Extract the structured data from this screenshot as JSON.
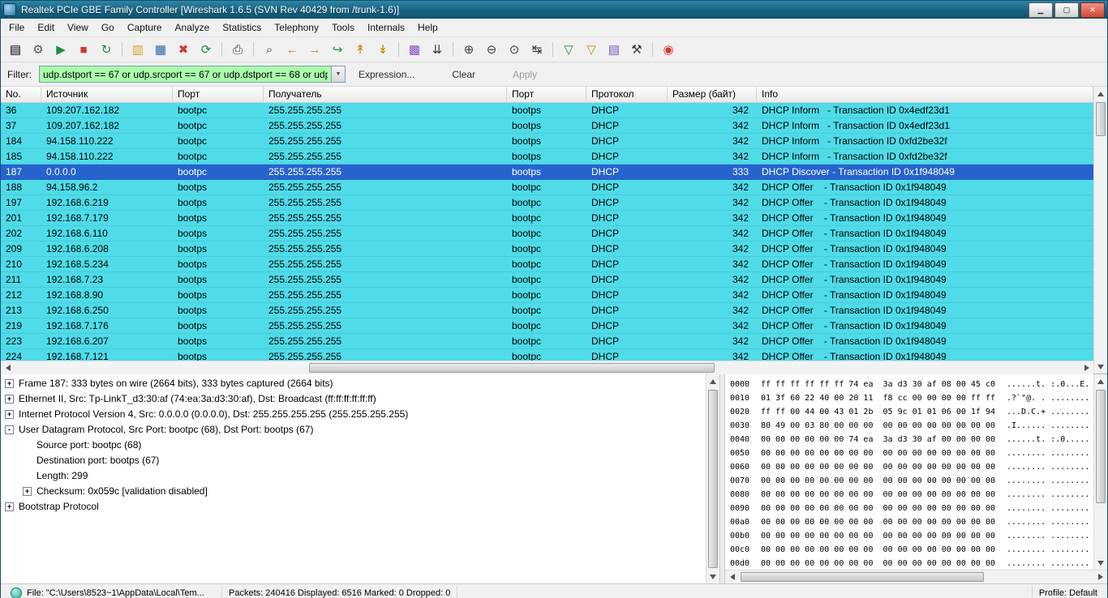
{
  "window": {
    "title": "Realtek PCIe GBE Family Controller   [Wireshark 1.6.5  (SVN Rev 40429 from /trunk-1.6)]",
    "controls": [
      {
        "name": "minimize-button",
        "glyph": "▁"
      },
      {
        "name": "maximize-button",
        "glyph": "▢"
      },
      {
        "name": "close-button",
        "glyph": "✕",
        "cls": "close"
      }
    ]
  },
  "menu": [
    {
      "name": "menu-file",
      "label": "File"
    },
    {
      "name": "menu-edit",
      "label": "Edit"
    },
    {
      "name": "menu-view",
      "label": "View"
    },
    {
      "name": "menu-go",
      "label": "Go"
    },
    {
      "name": "menu-capture",
      "label": "Capture"
    },
    {
      "name": "menu-analyze",
      "label": "Analyze"
    },
    {
      "name": "menu-statistics",
      "label": "Statistics"
    },
    {
      "name": "menu-telephony",
      "label": "Telephony"
    },
    {
      "name": "menu-tools",
      "label": "Tools"
    },
    {
      "name": "menu-internals",
      "label": "Internals"
    },
    {
      "name": "menu-help",
      "label": "Help"
    }
  ],
  "toolbar": [
    {
      "name": "list-interfaces-icon",
      "glyph": "▤",
      "cls": "c-dev"
    },
    {
      "name": "capture-options-icon",
      "glyph": "⚙",
      "cls": "c-gear"
    },
    {
      "name": "start-capture-icon",
      "glyph": "▶",
      "cls": "c-green"
    },
    {
      "name": "stop-capture-icon",
      "glyph": "■",
      "cls": "c-red"
    },
    {
      "name": "restart-capture-icon",
      "glyph": "↻",
      "cls": "c-green"
    },
    {
      "sep": true,
      "name": "toolbar-separator"
    },
    {
      "name": "open-file-icon",
      "glyph": "▥",
      "cls": "c-folder"
    },
    {
      "name": "save-file-icon",
      "glyph": "▦",
      "cls": "c-blue"
    },
    {
      "name": "close-file-icon",
      "glyph": "✖",
      "cls": "c-red"
    },
    {
      "name": "reload-icon",
      "glyph": "⟳",
      "cls": "c-green"
    },
    {
      "sep": true,
      "name": "toolbar-separator"
    },
    {
      "name": "print-icon",
      "glyph": "⎙",
      "cls": "c-dark"
    },
    {
      "sep": true,
      "name": "toolbar-separator"
    },
    {
      "name": "find-packet-icon",
      "glyph": "⌕",
      "cls": "c-dark"
    },
    {
      "name": "go-back-icon",
      "glyph": "←",
      "cls": "c-gold"
    },
    {
      "name": "go-forward-icon",
      "glyph": "→",
      "cls": "c-gold"
    },
    {
      "name": "goto-packet-icon",
      "glyph": "↪",
      "cls": "c-green"
    },
    {
      "name": "go-top-icon",
      "glyph": "↟",
      "cls": "c-gold"
    },
    {
      "name": "go-bottom-icon",
      "glyph": "↡",
      "cls": "c-gold"
    },
    {
      "sep": true,
      "name": "toolbar-separator"
    },
    {
      "name": "colorize-icon",
      "glyph": "▩",
      "cls": "c-multi"
    },
    {
      "name": "autoscroll-icon",
      "glyph": "⇊",
      "cls": "c-dark"
    },
    {
      "sep": true,
      "name": "toolbar-separator"
    },
    {
      "name": "zoom-in-icon",
      "glyph": "⊕",
      "cls": "c-dark"
    },
    {
      "name": "zoom-out-icon",
      "glyph": "⊖",
      "cls": "c-dark"
    },
    {
      "name": "zoom-100-icon",
      "glyph": "⊙",
      "cls": "c-dark"
    },
    {
      "name": "resize-columns-icon",
      "glyph": "↹",
      "cls": "c-dark"
    },
    {
      "sep": true,
      "name": "toolbar-separator"
    },
    {
      "name": "capture-filters-icon",
      "glyph": "▽",
      "cls": "c-green"
    },
    {
      "name": "display-filters-icon",
      "glyph": "▽",
      "cls": "c-gold"
    },
    {
      "name": "coloring-rules-icon",
      "glyph": "▤",
      "cls": "c-multi"
    },
    {
      "name": "preferences-icon",
      "glyph": "⚒",
      "cls": "c-dark"
    },
    {
      "sep": true,
      "name": "toolbar-separator"
    },
    {
      "name": "help-icon",
      "glyph": "◉",
      "cls": "c-red"
    }
  ],
  "filter": {
    "label": "Filter:",
    "value": "udp.dstport == 67 or udp.srcport == 67 or udp.dstport == 68 or udp.sr",
    "drop_glyph": "▼",
    "expression": "Expression...",
    "clear": "Clear",
    "apply": "Apply"
  },
  "packet_list": {
    "columns": [
      {
        "name": "col-no",
        "label": "No."
      },
      {
        "name": "col-source",
        "label": "Источник"
      },
      {
        "name": "col-src-port",
        "label": "Порт"
      },
      {
        "name": "col-destination",
        "label": "Получатель"
      },
      {
        "name": "col-dst-port",
        "label": "Порт"
      },
      {
        "name": "col-protocol",
        "label": "Протокол"
      },
      {
        "name": "col-length",
        "label": "Размер (байт)"
      },
      {
        "name": "col-info",
        "label": "Info"
      }
    ],
    "rows": [
      {
        "no": "36",
        "src": "109.207.162.182",
        "sport": "bootpc",
        "dst": "255.255.255.255",
        "dport": "bootps",
        "proto": "DHCP",
        "len": "342",
        "info": "DHCP Inform   - Transaction ID 0x4edf23d1"
      },
      {
        "no": "37",
        "src": "109.207.162.182",
        "sport": "bootpc",
        "dst": "255.255.255.255",
        "dport": "bootps",
        "proto": "DHCP",
        "len": "342",
        "info": "DHCP Inform   - Transaction ID 0x4edf23d1"
      },
      {
        "no": "184",
        "src": "94.158.110.222",
        "sport": "bootpc",
        "dst": "255.255.255.255",
        "dport": "bootps",
        "proto": "DHCP",
        "len": "342",
        "info": "DHCP Inform   - Transaction ID 0xfd2be32f"
      },
      {
        "no": "185",
        "src": "94.158.110.222",
        "sport": "bootpc",
        "dst": "255.255.255.255",
        "dport": "bootps",
        "proto": "DHCP",
        "len": "342",
        "info": "DHCP Inform   - Transaction ID 0xfd2be32f"
      },
      {
        "no": "187",
        "src": "0.0.0.0",
        "sport": "bootpc",
        "dst": "255.255.255.255",
        "dport": "bootps",
        "proto": "DHCP",
        "len": "333",
        "info": "DHCP Discover - Transaction ID 0x1f948049",
        "selected": true
      },
      {
        "no": "188",
        "src": "94.158.96.2",
        "sport": "bootps",
        "dst": "255.255.255.255",
        "dport": "bootpc",
        "proto": "DHCP",
        "len": "342",
        "info": "DHCP Offer    - Transaction ID 0x1f948049"
      },
      {
        "no": "197",
        "src": "192.168.6.219",
        "sport": "bootps",
        "dst": "255.255.255.255",
        "dport": "bootpc",
        "proto": "DHCP",
        "len": "342",
        "info": "DHCP Offer    - Transaction ID 0x1f948049"
      },
      {
        "no": "201",
        "src": "192.168.7.179",
        "sport": "bootps",
        "dst": "255.255.255.255",
        "dport": "bootpc",
        "proto": "DHCP",
        "len": "342",
        "info": "DHCP Offer    - Transaction ID 0x1f948049"
      },
      {
        "no": "202",
        "src": "192.168.6.110",
        "sport": "bootps",
        "dst": "255.255.255.255",
        "dport": "bootpc",
        "proto": "DHCP",
        "len": "342",
        "info": "DHCP Offer    - Transaction ID 0x1f948049"
      },
      {
        "no": "209",
        "src": "192.168.6.208",
        "sport": "bootps",
        "dst": "255.255.255.255",
        "dport": "bootpc",
        "proto": "DHCP",
        "len": "342",
        "info": "DHCP Offer    - Transaction ID 0x1f948049"
      },
      {
        "no": "210",
        "src": "192.168.5.234",
        "sport": "bootps",
        "dst": "255.255.255.255",
        "dport": "bootpc",
        "proto": "DHCP",
        "len": "342",
        "info": "DHCP Offer    - Transaction ID 0x1f948049"
      },
      {
        "no": "211",
        "src": "192.168.7.23",
        "sport": "bootps",
        "dst": "255.255.255.255",
        "dport": "bootpc",
        "proto": "DHCP",
        "len": "342",
        "info": "DHCP Offer    - Transaction ID 0x1f948049"
      },
      {
        "no": "212",
        "src": "192.168.8.90",
        "sport": "bootps",
        "dst": "255.255.255.255",
        "dport": "bootpc",
        "proto": "DHCP",
        "len": "342",
        "info": "DHCP Offer    - Transaction ID 0x1f948049"
      },
      {
        "no": "213",
        "src": "192.168.6.250",
        "sport": "bootps",
        "dst": "255.255.255.255",
        "dport": "bootpc",
        "proto": "DHCP",
        "len": "342",
        "info": "DHCP Offer    - Transaction ID 0x1f948049"
      },
      {
        "no": "219",
        "src": "192.168.7.176",
        "sport": "bootps",
        "dst": "255.255.255.255",
        "dport": "bootpc",
        "proto": "DHCP",
        "len": "342",
        "info": "DHCP Offer    - Transaction ID 0x1f948049"
      },
      {
        "no": "223",
        "src": "192.168.6.207",
        "sport": "bootps",
        "dst": "255.255.255.255",
        "dport": "bootpc",
        "proto": "DHCP",
        "len": "342",
        "info": "DHCP Offer    - Transaction ID 0x1f948049"
      },
      {
        "no": "224",
        "src": "192.168.7.121",
        "sport": "bootps",
        "dst": "255.255.255.255",
        "dport": "bootpc",
        "proto": "DHCP",
        "len": "342",
        "info": "DHCP Offer    - Transaction ID 0x1f948049"
      }
    ]
  },
  "details": [
    {
      "exp": "+",
      "text": "Frame 187: 333 bytes on wire (2664 bits), 333 bytes captured (2664 bits)"
    },
    {
      "exp": "+",
      "text": "Ethernet II, Src: Tp-LinkT_d3:30:af (74:ea:3a:d3:30:af), Dst: Broadcast (ff:ff:ff:ff:ff:ff)"
    },
    {
      "exp": "+",
      "text": "Internet Protocol Version 4, Src: 0.0.0.0 (0.0.0.0), Dst: 255.255.255.255 (255.255.255.255)"
    },
    {
      "exp": "-",
      "text": "User Datagram Protocol, Src Port: bootpc (68), Dst Port: bootps (67)"
    },
    {
      "exp": "",
      "text": "Source port: bootpc (68)",
      "cls": "ind1"
    },
    {
      "exp": "",
      "text": "Destination port: bootps (67)",
      "cls": "ind1"
    },
    {
      "exp": "",
      "text": "Length: 299",
      "cls": "ind1"
    },
    {
      "exp": "+",
      "text": "Checksum: 0x059c [validation disabled]",
      "cls": "ind1"
    },
    {
      "exp": "+",
      "text": "Bootstrap Protocol"
    }
  ],
  "hex_dump": [
    {
      "off": "0000",
      "hex": "ff ff ff ff ff ff 74 ea  3a d3 30 af 08 00 45 c0",
      "ascii": "......t. :.0...E."
    },
    {
      "off": "0010",
      "hex": "01 3f 60 22 40 00 20 11  f8 cc 00 00 00 00 ff ff",
      "ascii": ".?`\"@. . ........"
    },
    {
      "off": "0020",
      "hex": "ff ff 00 44 00 43 01 2b  05 9c 01 01 06 00 1f 94",
      "ascii": "...D.C.+ ........"
    },
    {
      "off": "0030",
      "hex": "80 49 00 03 80 00 00 00  00 00 00 00 00 00 00 00",
      "ascii": ".I...... ........"
    },
    {
      "off": "0040",
      "hex": "00 00 00 00 00 00 74 ea  3a d3 30 af 00 00 00 00",
      "ascii": "......t. :.0....."
    },
    {
      "off": "0050",
      "hex": "00 00 00 00 00 00 00 00  00 00 00 00 00 00 00 00",
      "ascii": "........ ........"
    },
    {
      "off": "0060",
      "hex": "00 00 00 00 00 00 00 00  00 00 00 00 00 00 00 00",
      "ascii": "........ ........"
    },
    {
      "off": "0070",
      "hex": "00 00 00 00 00 00 00 00  00 00 00 00 00 00 00 00",
      "ascii": "........ ........"
    },
    {
      "off": "0080",
      "hex": "00 00 00 00 00 00 00 00  00 00 00 00 00 00 00 00",
      "ascii": "........ ........"
    },
    {
      "off": "0090",
      "hex": "00 00 00 00 00 00 00 00  00 00 00 00 00 00 00 00",
      "ascii": "........ ........"
    },
    {
      "off": "00a0",
      "hex": "00 00 00 00 00 00 00 00  00 00 00 00 00 00 00 00",
      "ascii": "........ ........"
    },
    {
      "off": "00b0",
      "hex": "00 00 00 00 00 00 00 00  00 00 00 00 00 00 00 00",
      "ascii": "........ ........"
    },
    {
      "off": "00c0",
      "hex": "00 00 00 00 00 00 00 00  00 00 00 00 00 00 00 00",
      "ascii": "........ ........"
    },
    {
      "off": "00d0",
      "hex": "00 00 00 00 00 00 00 00  00 00 00 00 00 00 00 00",
      "ascii": "........ ........"
    }
  ],
  "status": {
    "file": "File: \"C:\\Users\\8523~1\\AppData\\Local\\Tem...",
    "packets": "Packets: 240416 Displayed: 6516 Marked: 0 Dropped: 0",
    "profile": "Profile: Default"
  },
  "colors": {
    "row_dhcp": "#4fdbe8",
    "row_selected": "#2663cd",
    "filter_valid": "#aaffaa",
    "titlebar": "#16607f"
  }
}
